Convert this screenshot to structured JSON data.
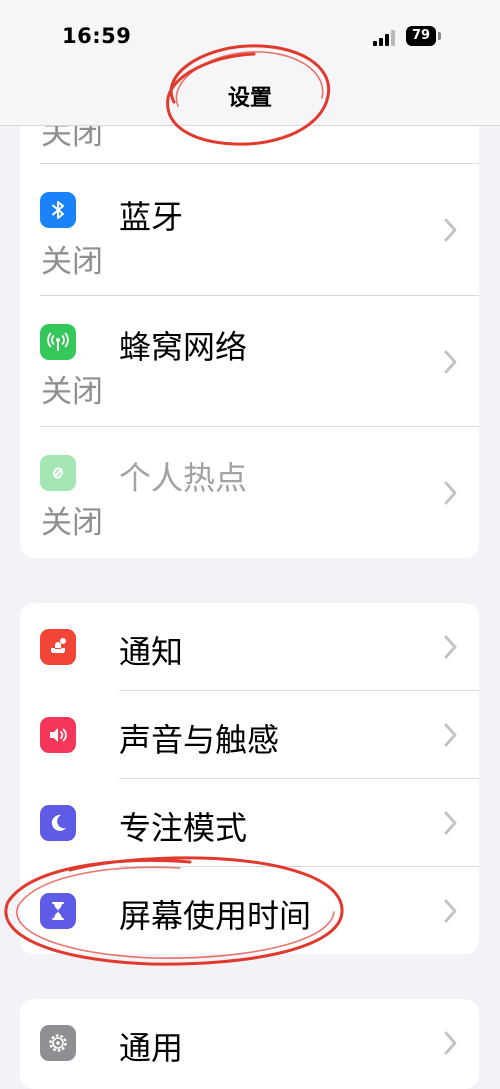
{
  "status_bar": {
    "time": "16:59",
    "battery": "79"
  },
  "nav": {
    "title": "设置"
  },
  "wifi_partial": {
    "status": "关闭"
  },
  "connectivity": [
    {
      "label": "蓝牙",
      "status": "关闭",
      "icon": "bluetooth-icon",
      "color": "#1a82fb"
    },
    {
      "label": "蜂窝网络",
      "status": "关闭",
      "icon": "cellular-icon",
      "color": "#34c759"
    },
    {
      "label": "个人热点",
      "status": "关闭",
      "icon": "hotspot-icon",
      "color": "#34c759",
      "disabled": true
    }
  ],
  "notifications_group": [
    {
      "label": "通知",
      "icon": "notification-icon",
      "color": "#f04437"
    },
    {
      "label": "声音与触感",
      "icon": "speaker-icon",
      "color": "#f3365a"
    },
    {
      "label": "专注模式",
      "icon": "moon-icon",
      "color": "#5e5ce6"
    },
    {
      "label": "屏幕使用时间",
      "icon": "hourglass-icon",
      "color": "#5e5ce6"
    }
  ],
  "general_group": [
    {
      "label": "通用",
      "icon": "gear-icon",
      "color": "#8e8e93"
    }
  ],
  "annotation_color": "#e03a2f"
}
